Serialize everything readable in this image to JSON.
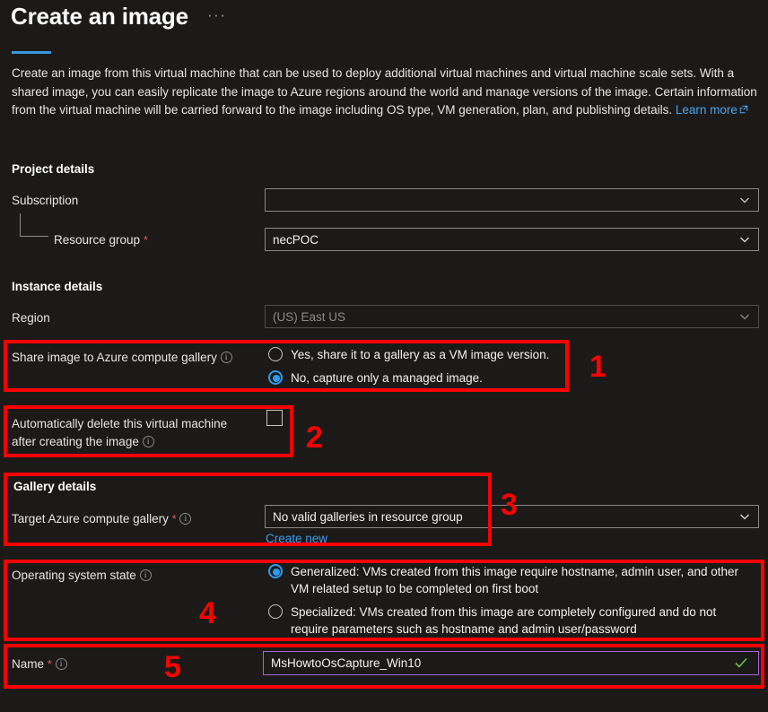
{
  "header": {
    "title": "Create an image",
    "more_menu": "···",
    "accent_color": "#3a96dd"
  },
  "intro": {
    "text_before_link": "Create an image from this virtual machine that can be used to deploy additional virtual machines and virtual machine scale sets. With a shared image, you can easily replicate the image to Azure regions around the world and manage versions of the image. Certain information from the virtual machine will be carried forward to the image including OS type, VM generation, plan, and publishing details. ",
    "link_label": "Learn more",
    "link_icon": "external-link-icon"
  },
  "project_details": {
    "heading": "Project details",
    "subscription": {
      "label": "Subscription",
      "value": "",
      "redacted": true,
      "redaction_color": "#ff0000",
      "icon": "chevron-down-icon"
    },
    "resource_group": {
      "label": "Resource group",
      "required": "*",
      "value": "necPOC",
      "icon": "chevron-down-icon"
    }
  },
  "instance_details": {
    "heading": "Instance details",
    "region": {
      "label": "Region",
      "value": "(US) East US",
      "disabled": true,
      "icon": "chevron-down-icon"
    }
  },
  "share_image": {
    "label": "Share image to Azure compute gallery",
    "info_icon": "info-icon",
    "options": [
      {
        "label": "Yes, share it to a gallery as a VM image version.",
        "selected": false
      },
      {
        "label": "No, capture only a managed image.",
        "selected": true
      }
    ]
  },
  "auto_delete": {
    "label_line1": "Automatically delete this virtual machine",
    "label_line2": "after creating the image",
    "info_icon": "info-icon",
    "checked": false
  },
  "gallery_details": {
    "heading": "Gallery details",
    "target_gallery": {
      "label": "Target Azure compute gallery",
      "required": "*",
      "info_icon": "info-icon",
      "value": "No valid galleries in resource group",
      "icon": "chevron-down-icon"
    },
    "create_new_link": "Create new"
  },
  "os_state": {
    "label": "Operating system state",
    "info_icon": "info-icon",
    "options": [
      {
        "label": "Generalized: VMs created from this image require hostname, admin user, and other VM related setup to be completed on first boot",
        "selected": true
      },
      {
        "label": "Specialized: VMs created from this image are completely configured and do not require parameters such as hostname and admin user/password",
        "selected": false
      }
    ]
  },
  "name_field": {
    "label": "Name",
    "required": "*",
    "info_icon": "info-icon",
    "value": "MsHowtoOsCapture_Win10",
    "placeholder": "",
    "validation_icon": "green-check-icon",
    "validation_color": "#6bbf47",
    "focus_border_color": "#a664d4"
  },
  "annotations": {
    "color": "#fe0000",
    "numbers": [
      "1",
      "2",
      "3",
      "4",
      "5"
    ]
  }
}
